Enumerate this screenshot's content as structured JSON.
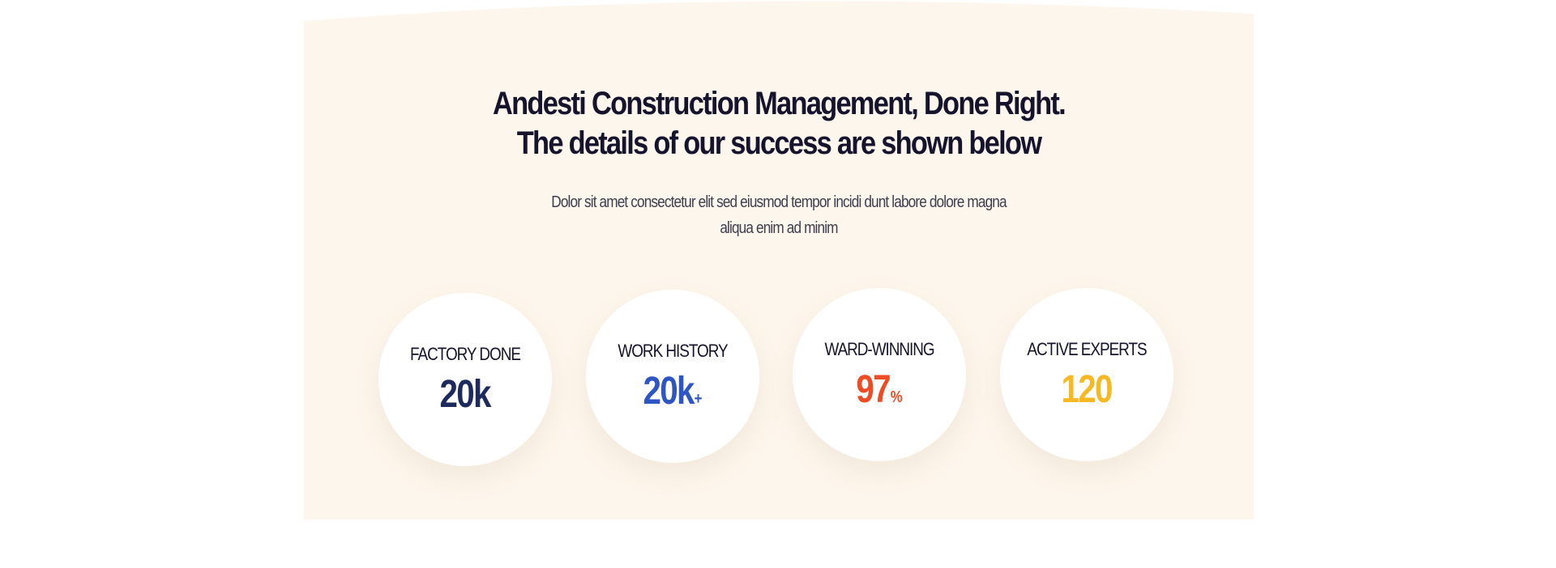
{
  "section": {
    "heading_line1": "Andesti Construction Management, Done Right.",
    "heading_line2": "The details of our success are shown below",
    "description_line1": "Dolor sit amet consectetur elit sed eiusmod tempor incidi dunt labore dolore magna",
    "description_line2": "aliqua enim ad minim",
    "background_color": "#fdf6ec"
  },
  "stats": [
    {
      "label": "FACTORY DONE",
      "value": "20k",
      "suffix": "",
      "color": "#1d2a5e"
    },
    {
      "label": "WORK HISTORY",
      "value": "20k",
      "suffix": "+",
      "color": "#2d55c4"
    },
    {
      "label": "WARD-WINNING",
      "value": "97",
      "suffix": "%",
      "color": "#ee4c24"
    },
    {
      "label": "ACTIVE EXPERTS",
      "value": "120",
      "suffix": "",
      "color": "#f6b823"
    }
  ]
}
